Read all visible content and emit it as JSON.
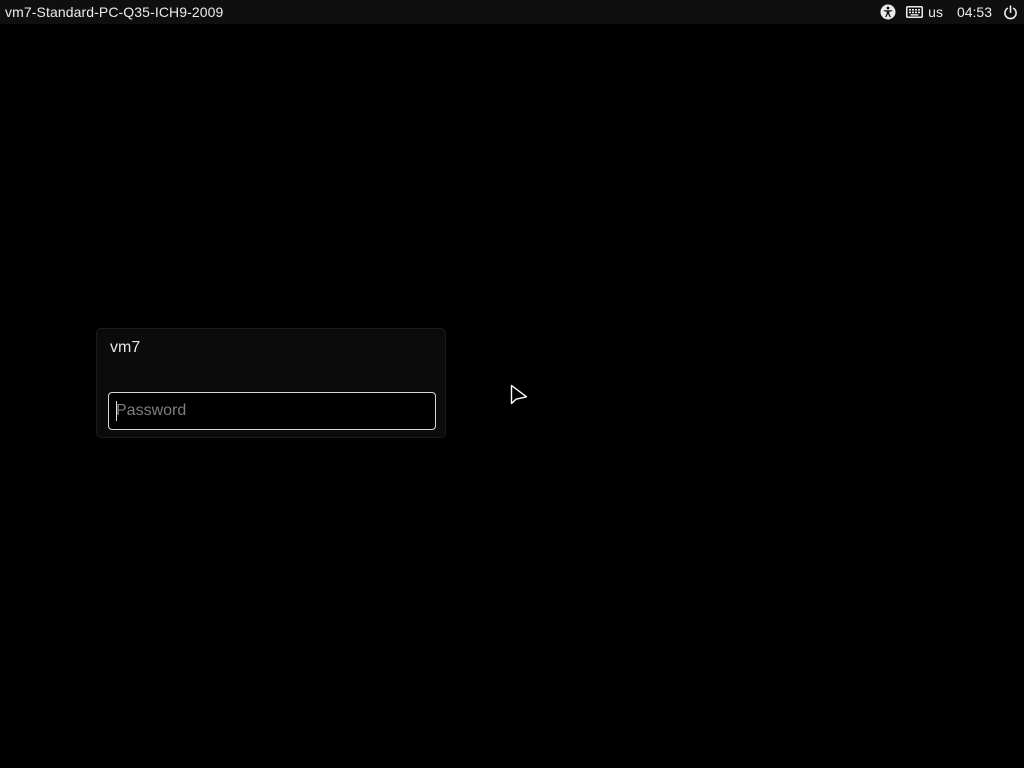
{
  "top_bar": {
    "hostname": "vm7-Standard-PC-Q35-ICH9-2009",
    "indicators": {
      "accessibility_icon": "accessibility-icon",
      "keyboard_icon": "keyboard-icon",
      "keyboard_layout": "us",
      "clock": "04:53",
      "power_icon": "power-icon"
    }
  },
  "login": {
    "username": "vm7",
    "password_placeholder": "Password",
    "password_value": ""
  },
  "colors": {
    "background": "#000000",
    "top_bar": "#0f0f0f",
    "card": "#0b0b0b",
    "input_border": "#d8d8d8",
    "text": "#e8e8e8"
  }
}
